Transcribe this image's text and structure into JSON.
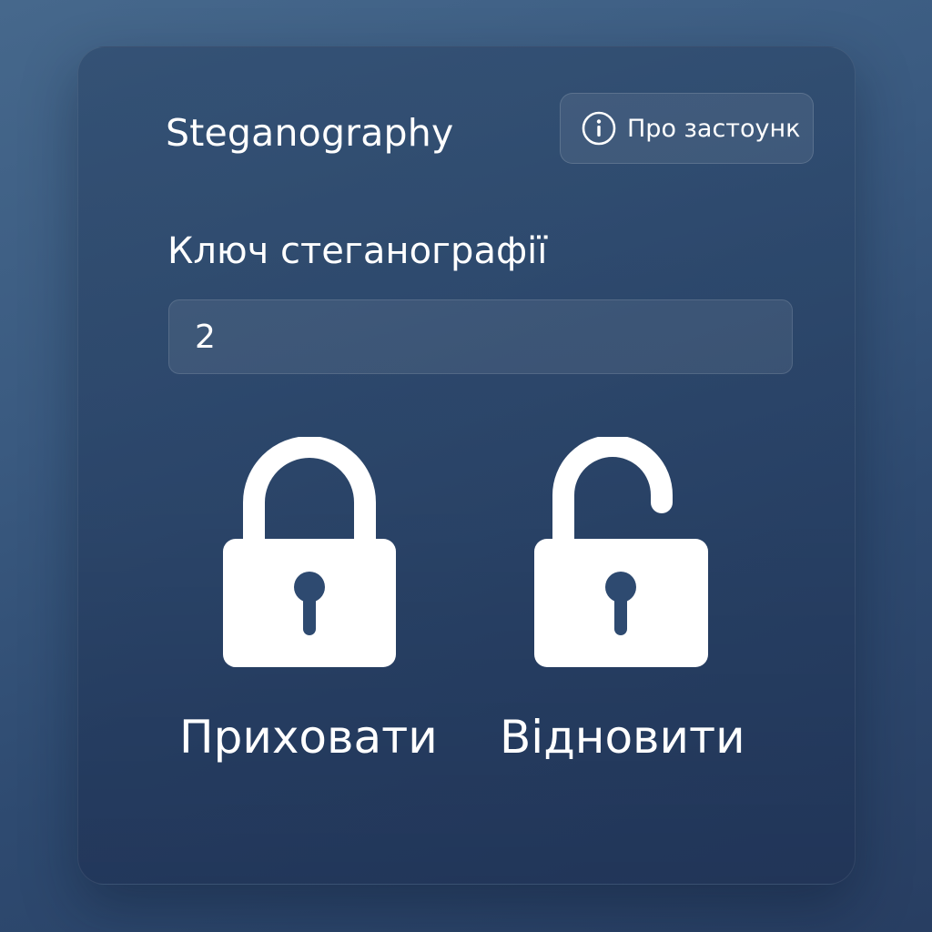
{
  "app": {
    "title": "Steganography"
  },
  "about_button": {
    "label": "Про застоунк",
    "icon": "info-icon"
  },
  "key": {
    "label": "Ключ стеганографії",
    "value": "2"
  },
  "actions": {
    "hide": {
      "label": "Приховати",
      "icon": "lock-closed-icon"
    },
    "restore": {
      "label": "Відновити",
      "icon": "lock-open-icon"
    }
  },
  "colors": {
    "background_top": "#46688c",
    "background_bottom": "#283e62",
    "text": "#ffffff"
  }
}
